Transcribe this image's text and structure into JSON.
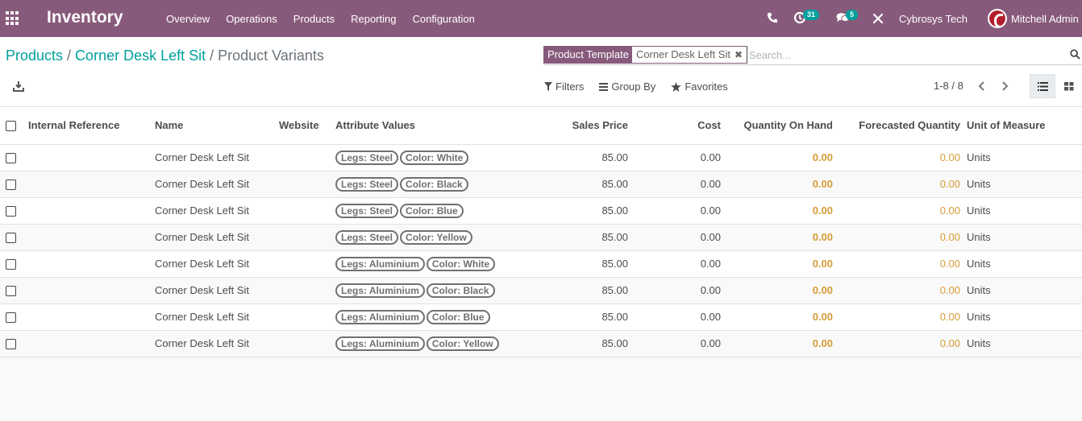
{
  "navbar": {
    "brand": "Inventory",
    "menu": [
      "Overview",
      "Operations",
      "Products",
      "Reporting",
      "Configuration"
    ],
    "activity_count": "31",
    "message_count": "5",
    "company": "Cybrosys Tech",
    "user": "Mitchell Admin",
    "colors": {
      "bar": "#875a7b",
      "badge": "#00a09d"
    },
    "icons": [
      "apps-icon",
      "phone-icon",
      "activity-icon",
      "chat-icon",
      "debug-icon",
      "avatar"
    ]
  },
  "breadcrumb": {
    "items": [
      "Products",
      "Corner Desk Left Sit"
    ],
    "separator": "/",
    "current": "Product Variants"
  },
  "search": {
    "facet_label": "Product Template",
    "facet_value": "Corner Desk Left Sit",
    "placeholder": "Search..."
  },
  "controls": {
    "filters": "Filters",
    "group_by": "Group By",
    "favorites": "Favorites",
    "pager": "1-8 / 8"
  },
  "table": {
    "columns": [
      "Internal Reference",
      "Name",
      "Website",
      "Attribute Values",
      "Sales Price",
      "Cost",
      "Quantity On Hand",
      "Forecasted Quantity",
      "Unit of Measure"
    ],
    "rows": [
      {
        "ref": "",
        "name": "Corner Desk Left Sit",
        "website": "",
        "attrs": [
          "Legs: Steel",
          "Color: White"
        ],
        "price": "85.00",
        "cost": "0.00",
        "qty": "0.00",
        "forecast": "0.00",
        "uom": "Units"
      },
      {
        "ref": "",
        "name": "Corner Desk Left Sit",
        "website": "",
        "attrs": [
          "Legs: Steel",
          "Color: Black"
        ],
        "price": "85.00",
        "cost": "0.00",
        "qty": "0.00",
        "forecast": "0.00",
        "uom": "Units"
      },
      {
        "ref": "",
        "name": "Corner Desk Left Sit",
        "website": "",
        "attrs": [
          "Legs: Steel",
          "Color: Blue"
        ],
        "price": "85.00",
        "cost": "0.00",
        "qty": "0.00",
        "forecast": "0.00",
        "uom": "Units"
      },
      {
        "ref": "",
        "name": "Corner Desk Left Sit",
        "website": "",
        "attrs": [
          "Legs: Steel",
          "Color: Yellow"
        ],
        "price": "85.00",
        "cost": "0.00",
        "qty": "0.00",
        "forecast": "0.00",
        "uom": "Units"
      },
      {
        "ref": "",
        "name": "Corner Desk Left Sit",
        "website": "",
        "attrs": [
          "Legs: Aluminium",
          "Color: White"
        ],
        "price": "85.00",
        "cost": "0.00",
        "qty": "0.00",
        "forecast": "0.00",
        "uom": "Units"
      },
      {
        "ref": "",
        "name": "Corner Desk Left Sit",
        "website": "",
        "attrs": [
          "Legs: Aluminium",
          "Color: Black"
        ],
        "price": "85.00",
        "cost": "0.00",
        "qty": "0.00",
        "forecast": "0.00",
        "uom": "Units"
      },
      {
        "ref": "",
        "name": "Corner Desk Left Sit",
        "website": "",
        "attrs": [
          "Legs: Aluminium",
          "Color: Blue"
        ],
        "price": "85.00",
        "cost": "0.00",
        "qty": "0.00",
        "forecast": "0.00",
        "uom": "Units"
      },
      {
        "ref": "",
        "name": "Corner Desk Left Sit",
        "website": "",
        "attrs": [
          "Legs: Aluminium",
          "Color: Yellow"
        ],
        "price": "85.00",
        "cost": "0.00",
        "qty": "0.00",
        "forecast": "0.00",
        "uom": "Units"
      }
    ]
  }
}
